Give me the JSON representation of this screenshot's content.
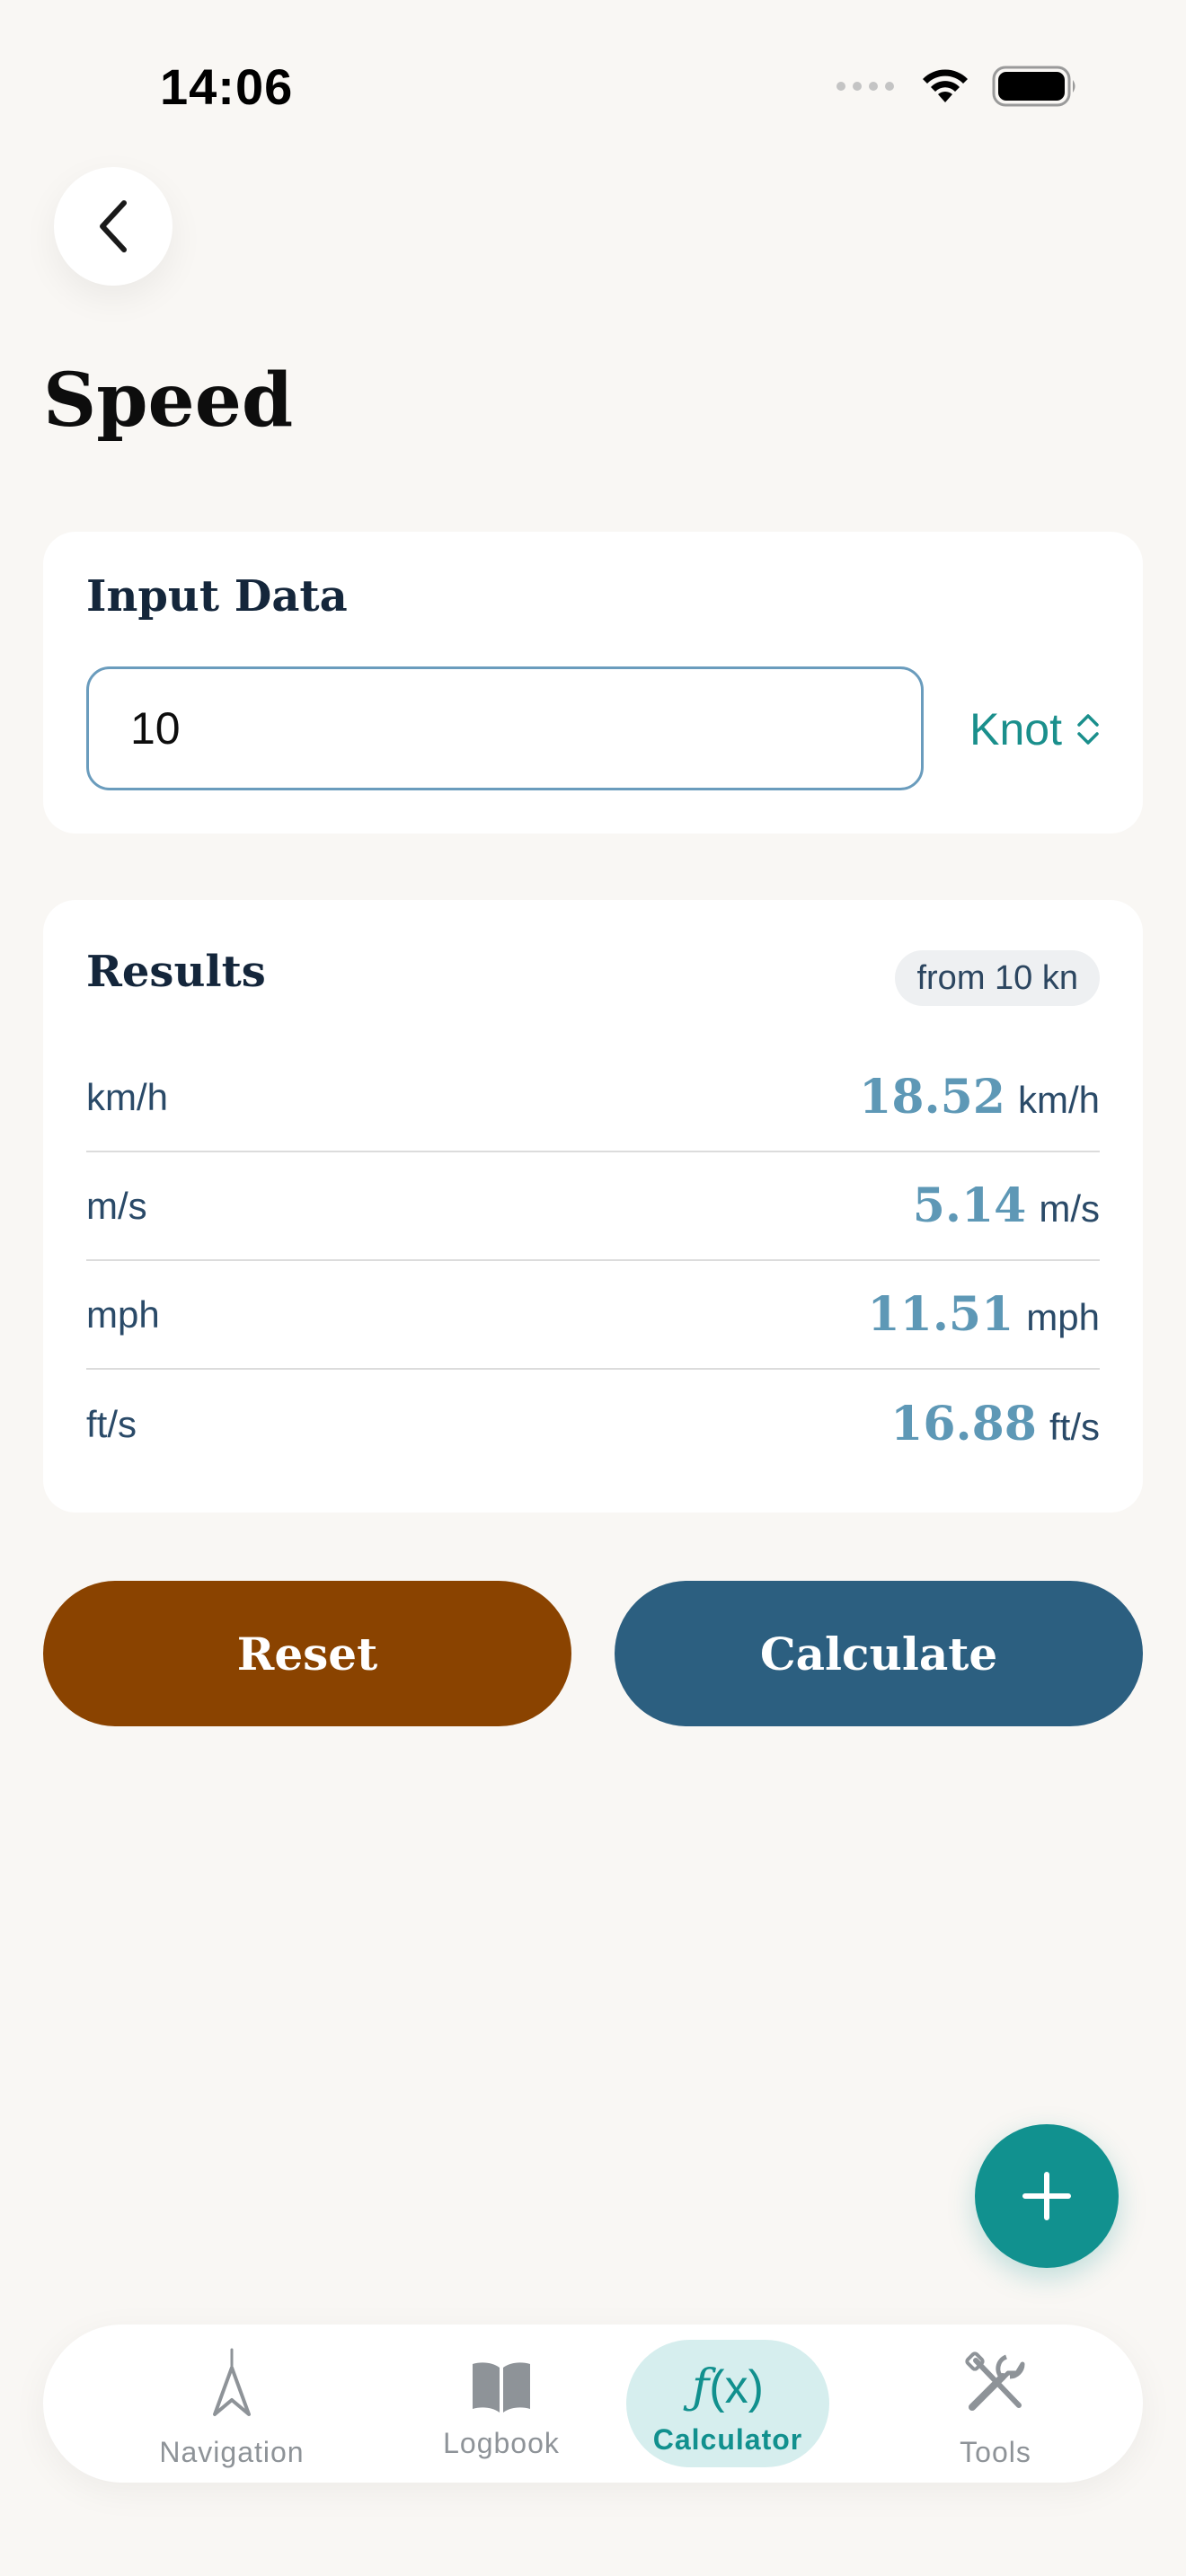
{
  "status_bar": {
    "time": "14:06"
  },
  "header": {
    "title": "Speed"
  },
  "input_card": {
    "title": "Input Data",
    "value": "10",
    "unit": "Knot"
  },
  "results_card": {
    "title": "Results",
    "badge": "from 10 kn",
    "rows": [
      {
        "unit": "km/h",
        "value": "18.52",
        "suffix": "km/h"
      },
      {
        "unit": "m/s",
        "value": "5.14",
        "suffix": "m/s"
      },
      {
        "unit": "mph",
        "value": "11.51",
        "suffix": "mph"
      },
      {
        "unit": "ft/s",
        "value": "16.88",
        "suffix": "ft/s"
      }
    ]
  },
  "actions": {
    "reset_label": "Reset",
    "calculate_label": "Calculate"
  },
  "tab_bar": {
    "items": [
      {
        "label": "Navigation",
        "icon": "compass-icon",
        "active": false
      },
      {
        "label": "Logbook",
        "icon": "book-icon",
        "active": false
      },
      {
        "label": "Calculator",
        "icon": "function-icon",
        "active": true
      },
      {
        "label": "Tools",
        "icon": "tools-icon",
        "active": false
      }
    ],
    "calculator_glyph": {
      "f": "ƒ",
      "args": "(x)"
    }
  },
  "colors": {
    "background": "#f9f7f4",
    "accent_teal": "#11918f",
    "reset": "#8a4300",
    "calculate": "#2c5f80",
    "result_value": "#5e98b6"
  }
}
